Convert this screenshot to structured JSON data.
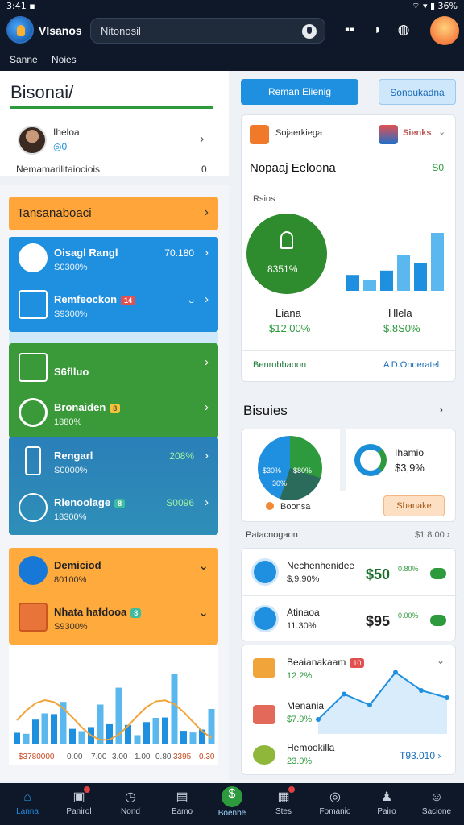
{
  "status": {
    "time": "3:41 ▪",
    "right": "⌔ ▾ ▮ 36%"
  },
  "app": {
    "title": "Vlsanos",
    "search_value": "Nitonosil"
  },
  "subnav": {
    "tab1": "Sanne",
    "tab2": "Noies"
  },
  "left": {
    "heading": "Bisonai/",
    "user_name": "Iheloa",
    "user_count": "◎0",
    "member_label": "Nemamarilitaiociois",
    "member_value": "0",
    "orange_row": "Tansanaboaci",
    "blue_items": [
      {
        "name": "Oisagl Rangl",
        "sub": "S0300%",
        "value": "70.180"
      },
      {
        "name": "Remfeockon",
        "badge": "14",
        "sub": "S9300%",
        "value": "ᴗ"
      }
    ],
    "green_items": [
      {
        "name": "S6flluo",
        "sub": "",
        "value": ""
      },
      {
        "name": "Bronaiden",
        "badge": "8",
        "sub": "1880%",
        "value": ""
      }
    ],
    "teal_items": [
      {
        "name": "Rengarl",
        "sub": "S0000%",
        "value": "208%"
      },
      {
        "name": "Rienoolage",
        "badge": "8",
        "sub": "18300%",
        "value": "S0096"
      }
    ],
    "orange_items": [
      {
        "name": "Demiciod",
        "sub": "80100%"
      },
      {
        "name": "Nhata hafdooa",
        "badge": "8",
        "sub": "S9300%"
      }
    ],
    "chart_labels": [
      "$3780000",
      "0.00",
      "7.00",
      "3.00",
      "1.00",
      "0.80",
      "1.00",
      "3395",
      "0.30"
    ]
  },
  "right": {
    "btn_primary": "Reman Elienig",
    "btn_secondary": "Sonoukadna",
    "card1": {
      "tag_left": "Sojaerkiega",
      "tag_right": "Sienks",
      "heading": "Nopaaj Eeloona",
      "heading_value": "S0",
      "sublabel": "Rsios",
      "circle_value": "8351%",
      "left_name": "Liana",
      "left_value": "$12.00%",
      "right_name": "Hlela",
      "right_value": "$.8S0%",
      "footer_left": "Benrobbaoon",
      "footer_right": "A  D.Onoeratel"
    },
    "section_title": "Bisuies",
    "card2": {
      "pie_a": "$30%",
      "pie_b": "$80%",
      "pie_c": "30%",
      "donut_name": "Ihamio",
      "donut_value": "$3,9%",
      "btn_left": "Boonsa",
      "btn_right": "Sbanake"
    },
    "pat_label": "Patacnogaon",
    "pat_value": "$1 8.00 ›",
    "stats": [
      {
        "name": "Nechenhenidee",
        "sub": "$,9.90%",
        "big": "$50",
        "small": "0.80%"
      },
      {
        "name": "Atinaoa",
        "sub": "11.30%",
        "big": "$95",
        "small": "0.00%"
      }
    ],
    "list": [
      {
        "name": "Beaianakaam",
        "badge": "10",
        "sub": "12.2%"
      },
      {
        "name": "Menania",
        "sub": "$7.9%"
      },
      {
        "name": "Hemookilla",
        "sub": "23.0%",
        "value": "T93.010 ›"
      }
    ]
  },
  "nav": [
    "Lanna",
    "Panirol",
    "Nond",
    "Eamo",
    "Boenbe",
    "Stes",
    "Fomanio",
    "Pairo",
    "Sacione"
  ],
  "chart_data": [
    {
      "type": "bar",
      "title": "",
      "categories": [
        "1",
        "2",
        "3",
        "4",
        "5",
        "6"
      ],
      "values": [
        22,
        15,
        28,
        50,
        38,
        80
      ],
      "ylim": [
        0,
        100
      ],
      "colors": [
        "#1f8fe0",
        "#5ab8ee"
      ]
    },
    {
      "type": "line",
      "title": "",
      "x": [
        1,
        2,
        3,
        4,
        5,
        6
      ],
      "values": [
        20,
        55,
        40,
        85,
        60,
        50
      ],
      "ylim": [
        0,
        100
      ]
    }
  ]
}
